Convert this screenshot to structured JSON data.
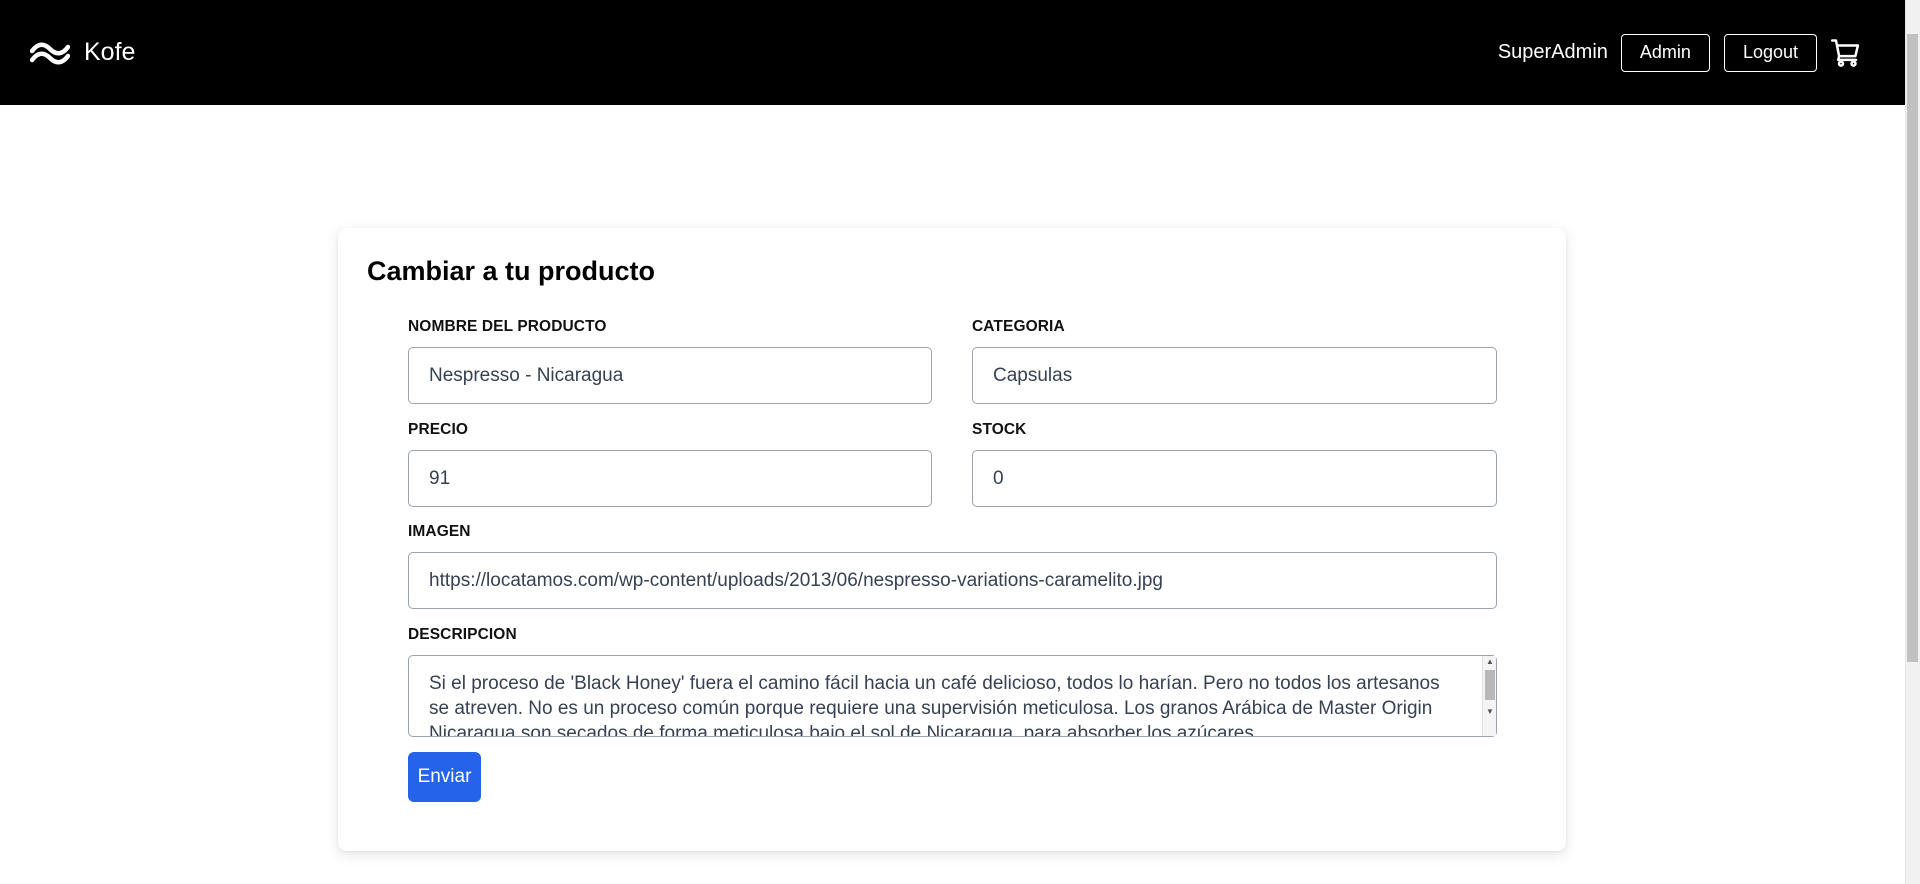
{
  "nav": {
    "brand": "Kofe",
    "user": "SuperAdmin",
    "admin_label": "Admin",
    "logout_label": "Logout"
  },
  "form": {
    "title": "Cambiar a tu producto",
    "name_label": "NOMBRE DEL PRODUCTO",
    "name_value": "Nespresso - Nicaragua",
    "category_label": "CATEGORIA",
    "category_value": "Capsulas",
    "price_label": "PRECIO",
    "price_value": "91",
    "stock_label": "STOCK",
    "stock_value": "0",
    "image_label": "IMAGEN",
    "image_value": "https://locatamos.com/wp-content/uploads/2013/06/nespresso-variations-caramelito.jpg",
    "description_label": "DESCRIPCION",
    "description_value": "Si el proceso de 'Black Honey' fuera el camino fácil hacia un café delicioso, todos lo harían. Pero no todos los artesanos se atreven. No es un proceso común porque requiere una supervisión meticulosa. Los granos Arábica de Master Origin Nicaragua son secados de forma meticulosa bajo el sol de Nicaragua, para absorber los azúcares",
    "submit_label": "Enviar"
  }
}
